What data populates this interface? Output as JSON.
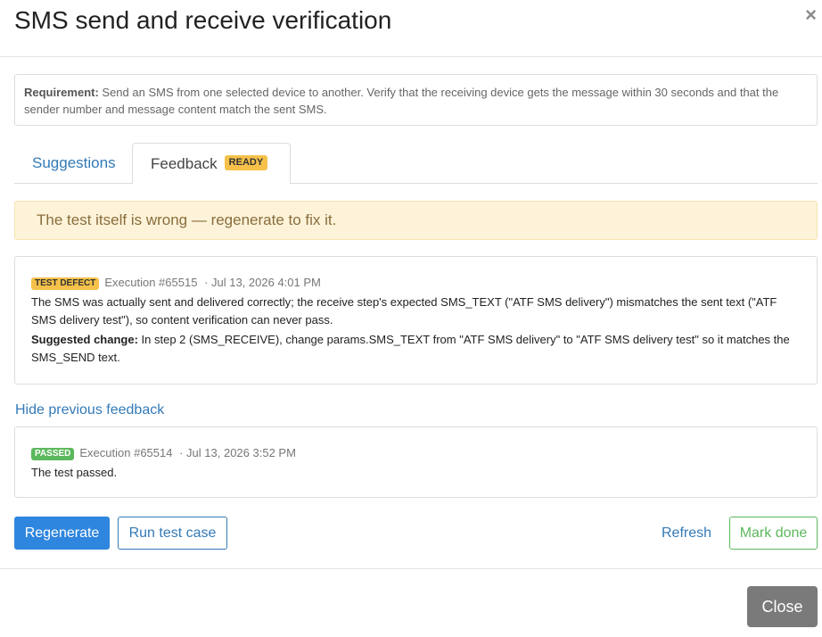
{
  "modal": {
    "title": "SMS send and receive verification",
    "close_glyph": "×"
  },
  "requirement": {
    "label": "Requirement:",
    "text": " Send an SMS from one selected device to another. Verify that the receiving device gets the message within 30 seconds and that the sender number and message content match the sent SMS."
  },
  "tabs": [
    {
      "label": "Suggestions",
      "active": false
    },
    {
      "label": "Feedback",
      "active": true,
      "badge": "READY"
    }
  ],
  "alert": {
    "text": "The test itself is wrong — regenerate to fix it."
  },
  "current_feedback": {
    "tag": "TEST DEFECT",
    "execution": "Execution #65515",
    "date": "· Jul 13, 2026 4:01 PM",
    "body": "The SMS was actually sent and delivered correctly; the receive step's expected SMS_TEXT (\"ATF SMS delivery\") mismatches the sent text (\"ATF SMS delivery test\"), so content verification can never pass.",
    "suggest_label": "Suggested change:",
    "suggest_text": " In step 2 (SMS_RECEIVE), change params.SMS_TEXT from \"ATF SMS delivery\" to \"ATF SMS delivery test\" so it matches the SMS_SEND text."
  },
  "hide_previous_link": "Hide previous feedback",
  "previous_feedback": {
    "tag": "PASSED",
    "execution": "Execution #65514",
    "date": "· Jul 13, 2026 3:52 PM",
    "body": "The test passed."
  },
  "actions": {
    "regenerate": "Regenerate",
    "run_test_case": "Run test case",
    "refresh": "Refresh",
    "mark_done": "Mark done"
  },
  "footer": {
    "close": "Close"
  },
  "colors": {
    "link": "#337ab7",
    "primary": "#2f86de",
    "warning_bg": "#fcf3d9",
    "warning_text": "#8a6d3b",
    "badge_yellow": "#f5c14a",
    "success": "#5cb85c",
    "close_button": "#7a7a7a"
  }
}
